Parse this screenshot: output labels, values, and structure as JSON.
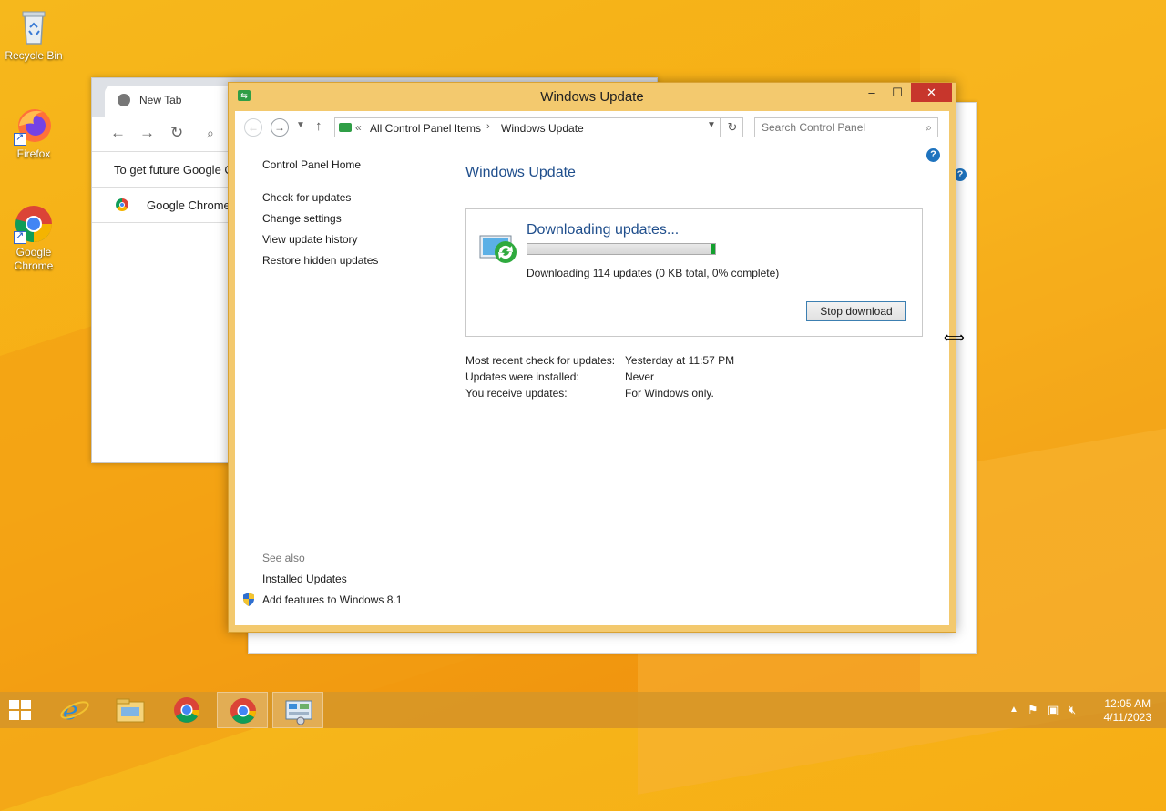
{
  "desktop": {
    "icons": [
      {
        "label": "Recycle Bin"
      },
      {
        "label": "Firefox"
      },
      {
        "label": "Google Chrome"
      }
    ]
  },
  "chrome_bg": {
    "tab_title": "New Tab",
    "infobar_text": "To get future Google C",
    "default_bar_text": "Google Chrome"
  },
  "window": {
    "title": "Windows Update",
    "address": {
      "crumb1": "All Control Panel Items",
      "crumb2": "Windows Update",
      "search_placeholder": "Search Control Panel"
    },
    "sidebar": {
      "home": "Control Panel Home",
      "links": [
        "Check for updates",
        "Change settings",
        "View update history",
        "Restore hidden updates"
      ],
      "see_also": "See also",
      "see_also_links": [
        "Installed Updates",
        "Add features to Windows 8.1"
      ]
    },
    "main": {
      "title": "Windows Update",
      "download_heading": "Downloading updates...",
      "progress_percent": 0,
      "download_status": "Downloading 114 updates (0 KB total, 0% complete)",
      "stop_button": "Stop download",
      "info": [
        {
          "label": "Most recent check for updates:",
          "value": "Yesterday at 11:57 PM"
        },
        {
          "label": "Updates were installed:",
          "value": "Never"
        },
        {
          "label": "You receive updates:",
          "value": "For Windows only."
        }
      ]
    }
  },
  "taskbar": {
    "clock_time": "12:05 AM",
    "clock_date": "4/11/2023"
  },
  "colors": {
    "accent": "#f3c96e",
    "close_button": "#c7362c",
    "progress": "#1fa53b",
    "link_title": "#1f4e8c"
  }
}
